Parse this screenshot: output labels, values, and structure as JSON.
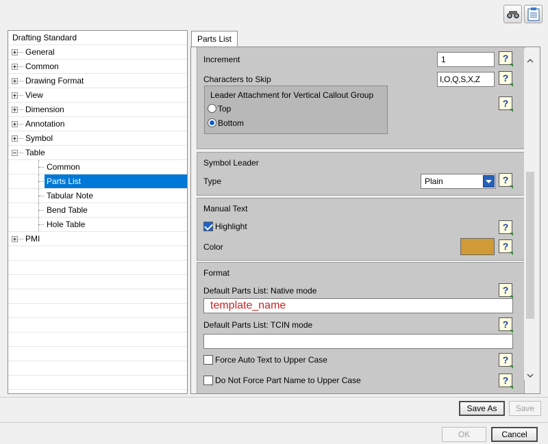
{
  "toolbar": {
    "icons": [
      "binoculars-icon",
      "clipboard-list-icon"
    ]
  },
  "tree": {
    "header": "Drafting Standard",
    "items": [
      {
        "label": "General",
        "level": 1,
        "expander": "plus"
      },
      {
        "label": "Common",
        "level": 1,
        "expander": "plus"
      },
      {
        "label": "Drawing Format",
        "level": 1,
        "expander": "plus"
      },
      {
        "label": "View",
        "level": 1,
        "expander": "plus"
      },
      {
        "label": "Dimension",
        "level": 1,
        "expander": "plus"
      },
      {
        "label": "Annotation",
        "level": 1,
        "expander": "plus"
      },
      {
        "label": "Symbol",
        "level": 1,
        "expander": "plus"
      },
      {
        "label": "Table",
        "level": 1,
        "expander": "minus"
      },
      {
        "label": "Common",
        "level": 2
      },
      {
        "label": "Parts List",
        "level": 2,
        "selected": true
      },
      {
        "label": "Tabular Note",
        "level": 2
      },
      {
        "label": "Bend Table",
        "level": 2
      },
      {
        "label": "Hole Table",
        "level": 2
      },
      {
        "label": "PMI",
        "level": 1,
        "expander": "plus"
      }
    ]
  },
  "tab": {
    "label": "Parts List"
  },
  "numbering": {
    "increment_label": "Increment",
    "increment_value": "1",
    "skip_label": "Characters to Skip",
    "skip_value": "I,O,Q,S,X,Z",
    "leader_group_title": "Leader Attachment for Vertical Callout Group",
    "radio_top": "Top",
    "radio_bottom": "Bottom",
    "selected_radio": "Bottom"
  },
  "symbol_leader": {
    "title": "Symbol Leader",
    "type_label": "Type",
    "type_value": "Plain"
  },
  "manual_text": {
    "title": "Manual Text",
    "highlight_label": "Highlight",
    "highlight_checked": true,
    "color_label": "Color",
    "color_value": "#d09a36"
  },
  "format": {
    "title": "Format",
    "native_label": "Default Parts List: Native mode",
    "native_value": "template_name",
    "native_value_color": "#d02020",
    "tcin_label": "Default Parts List: TCIN mode",
    "tcin_value": "",
    "force_upper_label": "Force Auto Text to Upper Case",
    "not_force_part_label": "Do Not Force Part Name to Upper Case"
  },
  "help_glyph": "?",
  "buttons": {
    "save_as": "Save As",
    "save": "Save",
    "ok": "OK",
    "cancel": "Cancel"
  }
}
